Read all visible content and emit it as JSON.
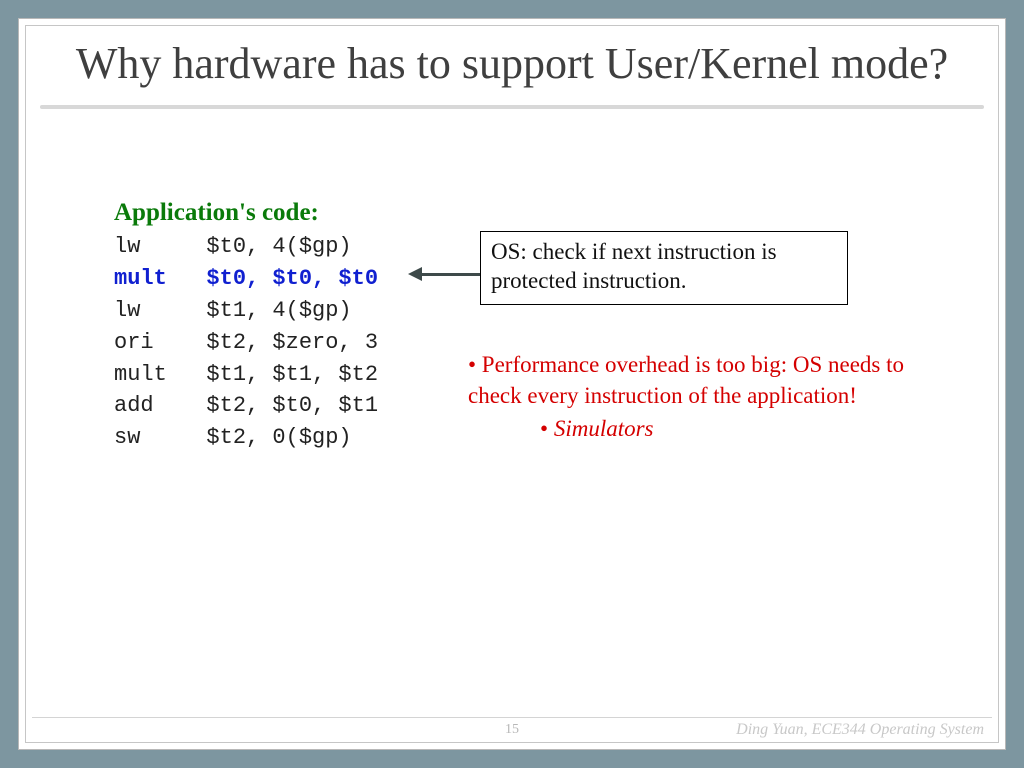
{
  "slide": {
    "title": "Why hardware has to support User/Kernel mode?",
    "code_heading": "Application's code:",
    "code": {
      "l1": "lw     $t0, 4($gp)",
      "l2": "mult   $t0, $t0, $t0",
      "l3": "lw     $t1, 4($gp)",
      "l4": "ori    $t2, $zero, 3",
      "l5": "mult   $t1, $t1, $t2",
      "l6": "add    $t2, $t0, $t1",
      "l7": "sw     $t2, 0($gp)"
    },
    "callout": "OS: check if next instruction is protected instruction.",
    "overhead_bullet": "• Performance overhead is too big: OS needs to check every instruction of the application!",
    "sim_bullet": "• ",
    "sim_word": "Simulators",
    "page_number": "15",
    "credit": "Ding Yuan, ECE344 Operating System"
  }
}
